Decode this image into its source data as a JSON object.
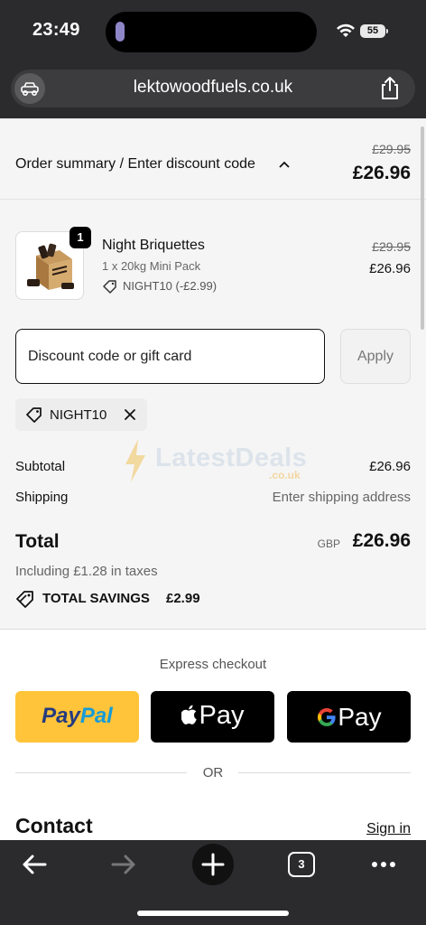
{
  "status_bar": {
    "time": "23:49",
    "battery": "55"
  },
  "browser": {
    "url": "lektowoodfuels.co.uk",
    "tab_count": "3"
  },
  "order_summary": {
    "toggle_label": "Order summary / Enter discount code",
    "original_total": "£29.95",
    "total": "£26.96"
  },
  "product": {
    "quantity": "1",
    "name": "Night Briquettes",
    "variant": "1 x 20kg Mini Pack",
    "discount": "NIGHT10 (-£2.99)",
    "original_price": "£29.95",
    "price": "£26.96"
  },
  "discount": {
    "placeholder": "Discount code or gift card",
    "apply_label": "Apply",
    "applied_code": "NIGHT10"
  },
  "watermark": {
    "text": "LatestDeals",
    "sub": ".co.uk"
  },
  "totals": {
    "subtotal_label": "Subtotal",
    "subtotal_value": "£26.96",
    "shipping_label": "Shipping",
    "shipping_value": "Enter shipping address",
    "total_label": "Total",
    "currency": "GBP",
    "total_value": "£26.96",
    "taxes": "Including £1.28 in taxes",
    "savings_label": "TOTAL SAVINGS",
    "savings_value": "£2.99"
  },
  "express": {
    "title": "Express checkout",
    "paypal_part1": "Pay",
    "paypal_part2": "Pal",
    "apple_pay": "Pay",
    "google_pay": "Pay",
    "or_label": "OR"
  },
  "contact": {
    "title": "Contact",
    "signin_label": "Sign in"
  },
  "colors": {
    "paypal_yellow": "#ffc439",
    "chrome_dark": "#2b2b2d"
  }
}
